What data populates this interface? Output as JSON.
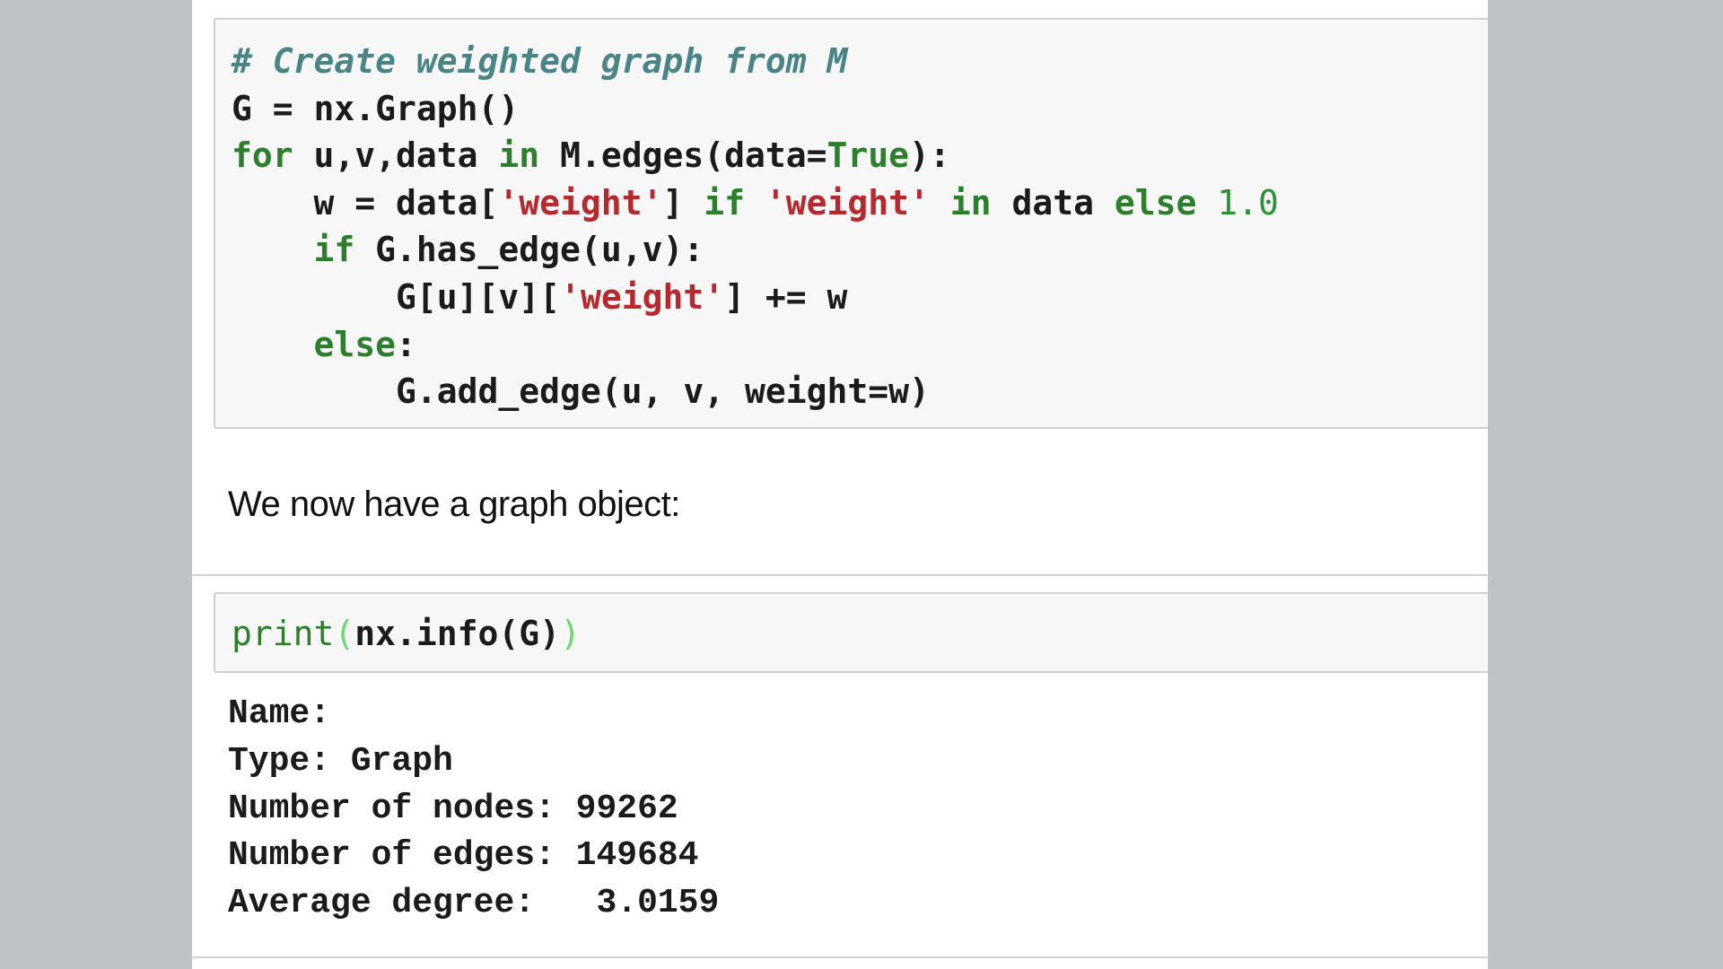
{
  "cell1": {
    "line1": {
      "comment": "# Create weighted graph from M"
    },
    "line2": {
      "text": "G = nx.Graph()"
    },
    "line3": {
      "kw_for": "for",
      "t1": " u,v,data ",
      "kw_in": "in",
      "t2": " M.edges(data=",
      "kw_true": "True",
      "t3": "):"
    },
    "line4": {
      "indent": "    ",
      "t1": "w = data[",
      "s1": "'weight'",
      "t2": "] ",
      "kw_if": "if",
      "t3": " ",
      "s2": "'weight'",
      "t4": " ",
      "kw_in": "in",
      "t5": " data ",
      "kw_else": "else",
      "t6": " ",
      "num": "1.0"
    },
    "line5": {
      "indent": "    ",
      "kw_if": "if",
      "t1": " G.has_edge(u,v):"
    },
    "line6": {
      "indent": "        ",
      "t1": "G[u][v][",
      "s1": "'weight'",
      "t2": "] += w"
    },
    "line7": {
      "indent": "    ",
      "kw_else": "else",
      "t1": ":"
    },
    "line8": {
      "indent": "        ",
      "t1": "G.add_edge(u, v, weight=w)"
    }
  },
  "markdown": {
    "text": "We now have a graph object:"
  },
  "cell3": {
    "fn": "print",
    "paren_open": "(",
    "arg": "nx.info(G)",
    "paren_close": ")"
  },
  "output": {
    "lines": [
      "Name:",
      "Type: Graph",
      "Number of nodes: 99262",
      "Number of edges: 149684",
      "Average degree:   3.0159"
    ]
  }
}
